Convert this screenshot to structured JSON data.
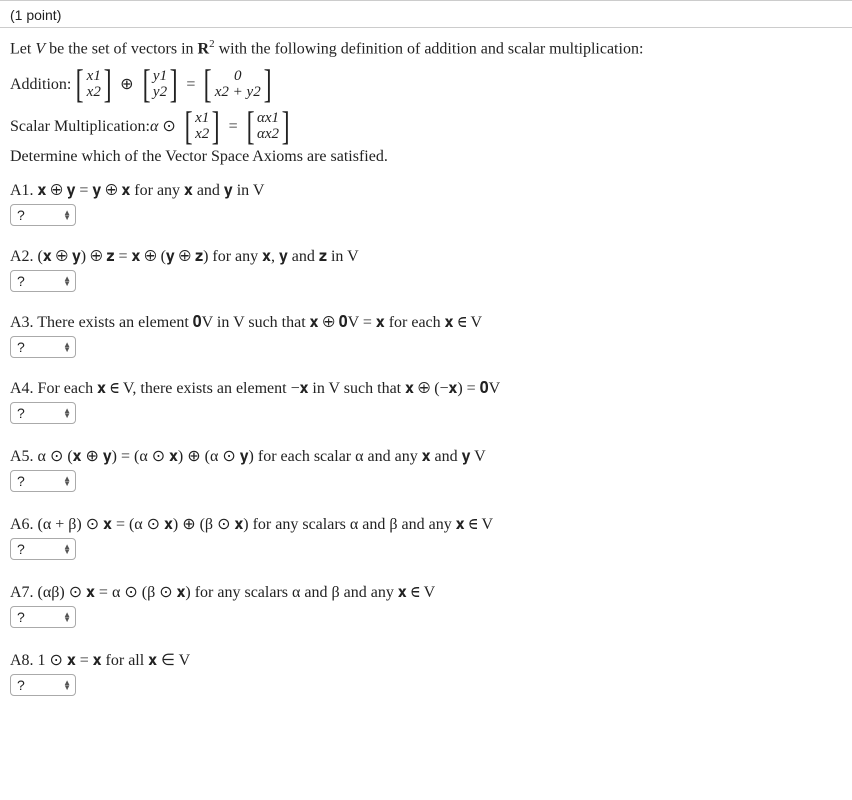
{
  "header": {
    "points": "(1 point)"
  },
  "intro": {
    "prefix": "Let ",
    "V": "V",
    "mid": " be the set of vectors in ",
    "R": "R",
    "exp": "2",
    "suffix": " with the following definition of addition and scalar multiplication:"
  },
  "addition": {
    "label": "Addition: ",
    "m1r1": "x1",
    "m1r2": "x2",
    "op1": "⊕",
    "m2r1": "y1",
    "m2r2": "y2",
    "eq": "=",
    "m3r1": "0",
    "m3r2": "x2 + y2"
  },
  "scalar": {
    "label": "Scalar Multiplication: ",
    "alpha": "α",
    "op": "⊙",
    "m1r1": "x1",
    "m1r2": "x2",
    "eq": "=",
    "m2r1": "αx1",
    "m2r2": "αx2"
  },
  "instruction": "Determine which of the Vector Space Axioms are satisfied.",
  "select_placeholder": "?",
  "axioms": {
    "a1": "A1. 𝐱 ⊕ 𝐲 = 𝐲 ⊕ 𝐱 for any 𝐱 and 𝐲 in V",
    "a2": "A2. (𝐱 ⊕ 𝐲) ⊕ 𝐳 = 𝐱 ⊕ (𝐲 ⊕ 𝐳) for any 𝐱, 𝐲 and 𝐳 in V",
    "a3": "A3. There exists an element 𝟎V in V such that 𝐱 ⊕ 𝟎V = 𝐱 for each 𝐱 ∈ V",
    "a4": "A4. For each 𝐱 ∈ V, there exists an element −𝐱 in V such that 𝐱 ⊕ (−𝐱) = 𝟎V",
    "a5": "A5. α ⊙ (𝐱 ⊕ 𝐲) = (α ⊙ 𝐱) ⊕ (α ⊙ 𝐲) for each scalar α and any 𝐱 and 𝐲 V",
    "a6": "A6. (α + β) ⊙ 𝐱 = (α ⊙ 𝐱) ⊕ (β ⊙ 𝐱) for any scalars α and β and any 𝐱 ∈ V",
    "a7": "A7. (αβ) ⊙ 𝐱 = α ⊙ (β ⊙ 𝐱) for any scalars α and β and any 𝐱 ∈ V",
    "a8": "A8. 1 ⊙ 𝐱 = 𝐱 for all 𝐱 ∈ V"
  }
}
